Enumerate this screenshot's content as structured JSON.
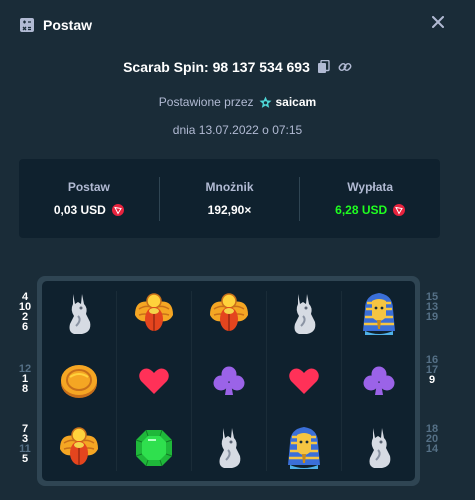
{
  "header": {
    "title": "Postaw",
    "icon": "bet-slip-icon",
    "close_icon": "close-icon"
  },
  "bet": {
    "id_text": "Scarab Spin: 98 137 534 693",
    "copy_icon": "copy-icon",
    "link_icon": "link-icon",
    "placed_by_label": "Postawione przez",
    "username": "saicam",
    "date_text": "dnia 13.07.2022 o 07:15"
  },
  "stats": {
    "bet_label": "Postaw",
    "bet_value": "0,03 USD",
    "multiplier_label": "Mnożnik",
    "multiplier_value": "192,90×",
    "payout_label": "Wypłata",
    "payout_value": "6,28 USD",
    "currency_icon": "tron-coin-icon",
    "payout_color": "#1fff20"
  },
  "grid": {
    "rows": [
      [
        "anubis",
        "scarab",
        "scarab",
        "anubis",
        "pharaoh"
      ],
      [
        "coin",
        "heart",
        "club",
        "heart",
        "club"
      ],
      [
        "scarab",
        "emerald",
        "anubis",
        "pharaoh",
        "anubis"
      ]
    ]
  },
  "paylines": {
    "left": [
      [
        "4",
        "10",
        "2",
        "6"
      ],
      [
        "12",
        "1",
        "8"
      ],
      [
        "7",
        "3",
        "11",
        "5"
      ]
    ],
    "right": [
      [
        "15",
        "13",
        "19"
      ],
      [
        "16",
        "17",
        "9"
      ],
      [
        "18",
        "20",
        "14"
      ]
    ]
  }
}
